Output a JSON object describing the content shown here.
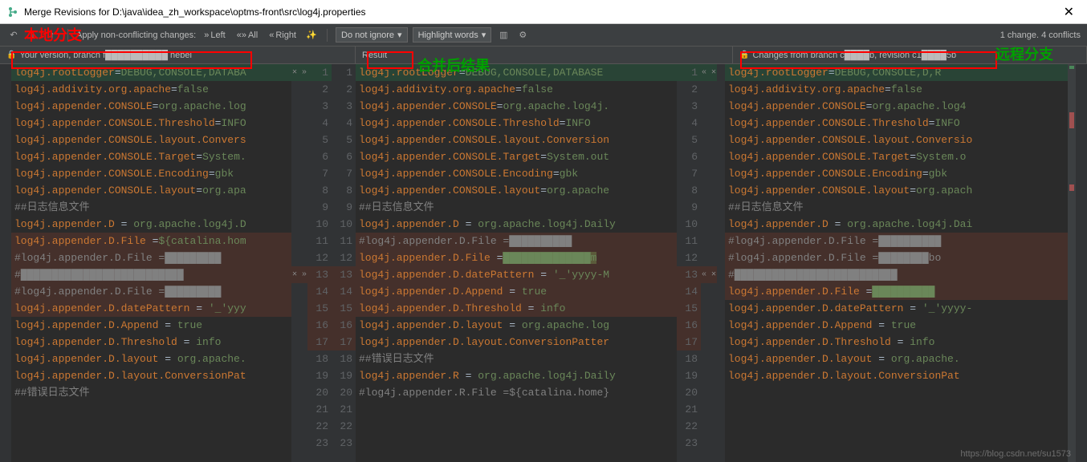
{
  "window": {
    "title": "Merge Revisions for D:\\java\\idea_zh_workspace\\optms-front\\src\\log4j.properties",
    "close": "✕"
  },
  "annotations": {
    "local": "本地分支",
    "result": "合并后结果",
    "remote": "远程分支"
  },
  "toolbar": {
    "apply_label": "Apply non-conflicting changes:",
    "left": "Left",
    "all": "All",
    "right": "Right",
    "ignore_dd": "Do not ignore",
    "highlight_dd": "Highlight words",
    "status": "1 change. 4 conflicts"
  },
  "headers": {
    "left": "Your version, branch f██████████ hebei",
    "center": "Result",
    "right": "Changes from branch c████b, revision c1████5b"
  },
  "code": {
    "left": [
      {
        "n": 1,
        "c": "diff-modify",
        "t": [
          [
            "key",
            "log4j.rootLogger"
          ],
          [
            "txt",
            "="
          ],
          [
            "val",
            "DEBUG,CONSOLE,DATABA"
          ]
        ]
      },
      {
        "n": 2,
        "t": [
          [
            "key",
            "log4j.addivity.org.apache"
          ],
          [
            "txt",
            "="
          ],
          [
            "val",
            "false"
          ]
        ]
      },
      {
        "n": 3,
        "t": []
      },
      {
        "n": 4,
        "t": [
          [
            "key",
            "log4j.appender.CONSOLE"
          ],
          [
            "txt",
            "="
          ],
          [
            "val",
            "org.apache.log"
          ]
        ]
      },
      {
        "n": 5,
        "t": [
          [
            "key",
            "log4j.appender.CONSOLE.Threshold"
          ],
          [
            "txt",
            "="
          ],
          [
            "val",
            "INFO"
          ]
        ]
      },
      {
        "n": 6,
        "t": [
          [
            "key",
            "log4j.appender.CONSOLE.layout.Convers"
          ]
        ]
      },
      {
        "n": 7,
        "t": [
          [
            "key",
            "log4j.appender.CONSOLE.Target"
          ],
          [
            "txt",
            "="
          ],
          [
            "val",
            "System."
          ]
        ]
      },
      {
        "n": 8,
        "t": [
          [
            "key",
            "log4j.appender.CONSOLE.Encoding"
          ],
          [
            "txt",
            "="
          ],
          [
            "val",
            "gbk"
          ]
        ]
      },
      {
        "n": 9,
        "t": [
          [
            "key",
            "log4j.appender.CONSOLE.layout"
          ],
          [
            "txt",
            "="
          ],
          [
            "val",
            "org.apa"
          ]
        ]
      },
      {
        "n": 10,
        "t": []
      },
      {
        "n": 11,
        "t": [
          [
            "comment",
            "##日志信息文件"
          ]
        ]
      },
      {
        "n": 12,
        "t": [
          [
            "key",
            "log4j.appender.D"
          ],
          [
            "txt",
            " = "
          ],
          [
            "val",
            "org.apache.log4j.D"
          ]
        ]
      },
      {
        "n": 13,
        "c": "diff-conflict",
        "t": [
          [
            "key",
            "log4j.appender.D.File"
          ],
          [
            "txt",
            " ="
          ],
          [
            "val",
            "${catalina.hom"
          ]
        ]
      },
      {
        "n": 14,
        "c": "diff-conflict",
        "t": [
          [
            "comment",
            "#log4j.appender.D.File =█████████"
          ]
        ]
      },
      {
        "n": 15,
        "c": "diff-conflict",
        "t": [
          [
            "comment",
            "#██████████████████████████"
          ]
        ]
      },
      {
        "n": 16,
        "c": "diff-conflict",
        "t": [
          [
            "comment",
            "#log4j.appender.D.File =█████████"
          ]
        ]
      },
      {
        "n": 17,
        "c": "diff-conflict",
        "t": [
          [
            "key",
            "log4j.appender.D.datePattern"
          ],
          [
            "txt",
            " = "
          ],
          [
            "val",
            "'_'yyy"
          ]
        ]
      },
      {
        "n": 18,
        "t": [
          [
            "key",
            "log4j.appender.D.Append"
          ],
          [
            "txt",
            " = "
          ],
          [
            "val",
            "true"
          ]
        ]
      },
      {
        "n": 19,
        "t": [
          [
            "key",
            "log4j.appender.D.Threshold"
          ],
          [
            "txt",
            " = "
          ],
          [
            "val",
            "info"
          ]
        ]
      },
      {
        "n": 20,
        "t": [
          [
            "key",
            "log4j.appender.D.layout"
          ],
          [
            "txt",
            " = "
          ],
          [
            "val",
            "org.apache."
          ]
        ]
      },
      {
        "n": 21,
        "t": [
          [
            "key",
            "log4j.appender.D.layout.ConversionPat"
          ]
        ]
      },
      {
        "n": 22,
        "t": []
      },
      {
        "n": 23,
        "t": [
          [
            "comment",
            "##错误日志文件"
          ]
        ]
      }
    ],
    "center_gutter": [
      {
        "l": 1,
        "r": 1,
        "la": "✕ »",
        "ra": "",
        "lc": "diff-modify"
      },
      {
        "l": 2,
        "r": 2
      },
      {
        "l": 3,
        "r": 3
      },
      {
        "l": 4,
        "r": 4
      },
      {
        "l": 5,
        "r": 5
      },
      {
        "l": 6,
        "r": 6
      },
      {
        "l": 7,
        "r": 7
      },
      {
        "l": 8,
        "r": 8
      },
      {
        "l": 9,
        "r": 9
      },
      {
        "l": 10,
        "r": 10
      },
      {
        "l": 11,
        "r": 11
      },
      {
        "l": 12,
        "r": 12
      },
      {
        "l": 13,
        "r": 13,
        "la": "✕ »",
        "ra": "« ✕",
        "lc": "diff-conflict",
        "rc": "diff-conflict"
      },
      {
        "l": 14,
        "r": 14,
        "la": "",
        "ra": "",
        "lc": "diff-conflict",
        "rc": "diff-conflict"
      },
      {
        "l": 15,
        "r": 15,
        "lc": "diff-conflict",
        "rc": "diff-conflict"
      },
      {
        "l": 16,
        "r": 16,
        "lc": "diff-conflict",
        "rc": "diff-conflict"
      },
      {
        "l": 17,
        "r": 17,
        "lc": "diff-conflict",
        "rc": "diff-conflict"
      },
      {
        "l": 18,
        "r": 18
      },
      {
        "l": 19,
        "r": 19
      },
      {
        "l": 20,
        "r": 20
      },
      {
        "l": 21,
        "r": 21
      },
      {
        "l": 22,
        "r": 22
      },
      {
        "l": 23,
        "r": 23
      }
    ],
    "center": [
      {
        "t": [
          [
            "key",
            "log4j.rootLogger"
          ],
          [
            "txt",
            "="
          ],
          [
            "val",
            "DEBUG,CONSOLE,DATABASE"
          ]
        ],
        "c": "diff-modify"
      },
      {
        "t": [
          [
            "key",
            "log4j.addivity.org.apache"
          ],
          [
            "txt",
            "="
          ],
          [
            "val",
            "false"
          ]
        ]
      },
      {
        "t": []
      },
      {
        "t": [
          [
            "key",
            "log4j.appender.CONSOLE"
          ],
          [
            "txt",
            "="
          ],
          [
            "val",
            "org.apache.log4j."
          ]
        ]
      },
      {
        "t": [
          [
            "key",
            "log4j.appender.CONSOLE.Threshold"
          ],
          [
            "txt",
            "="
          ],
          [
            "val",
            "INFO"
          ]
        ]
      },
      {
        "t": [
          [
            "key",
            "log4j.appender.CONSOLE.layout.Conversion"
          ]
        ]
      },
      {
        "t": [
          [
            "key",
            "log4j.appender.CONSOLE.Target"
          ],
          [
            "txt",
            "="
          ],
          [
            "val",
            "System.out"
          ]
        ]
      },
      {
        "t": [
          [
            "key",
            "log4j.appender.CONSOLE.Encoding"
          ],
          [
            "txt",
            "="
          ],
          [
            "val",
            "gbk"
          ]
        ]
      },
      {
        "t": [
          [
            "key",
            "log4j.appender.CONSOLE.layout"
          ],
          [
            "txt",
            "="
          ],
          [
            "val",
            "org.apache"
          ]
        ]
      },
      {
        "t": []
      },
      {
        "t": [
          [
            "comment",
            "##日志信息文件"
          ]
        ]
      },
      {
        "t": [
          [
            "key",
            "log4j.appender.D"
          ],
          [
            "txt",
            " = "
          ],
          [
            "val",
            "org.apache.log4j.Daily"
          ]
        ]
      },
      {
        "t": [
          [
            "comment",
            "#log4j.appender.D.File =██████████"
          ]
        ],
        "c": "diff-conflict"
      },
      {
        "t": [
          [
            "key",
            "log4j.appender.D.File"
          ],
          [
            "txt",
            " ="
          ],
          [
            "highlight",
            "██████████████m"
          ]
        ],
        "c": "diff-conflict"
      },
      {
        "t": [
          [
            "key",
            "log4j.appender.D.datePattern"
          ],
          [
            "txt",
            " = "
          ],
          [
            "val",
            "'_'yyyy-M"
          ]
        ],
        "c": "diff-conflict"
      },
      {
        "t": [
          [
            "key",
            "log4j.appender.D.Append"
          ],
          [
            "txt",
            " = "
          ],
          [
            "val",
            "true"
          ]
        ],
        "c": "diff-conflict"
      },
      {
        "t": [
          [
            "key",
            "log4j.appender.D.Threshold"
          ],
          [
            "txt",
            " = "
          ],
          [
            "val",
            "info"
          ]
        ],
        "c": "diff-conflict"
      },
      {
        "t": [
          [
            "key",
            "log4j.appender.D.layout"
          ],
          [
            "txt",
            " = "
          ],
          [
            "val",
            "org.apache.log"
          ]
        ]
      },
      {
        "t": [
          [
            "key",
            "log4j.appender.D.layout.ConversionPatter"
          ]
        ]
      },
      {
        "t": []
      },
      {
        "t": [
          [
            "comment",
            "##错误日志文件"
          ]
        ]
      },
      {
        "t": [
          [
            "key",
            "log4j.appender.R"
          ],
          [
            "txt",
            " = "
          ],
          [
            "val",
            "org.apache.log4j.Daily"
          ]
        ]
      },
      {
        "t": [
          [
            "comment",
            "#log4j.appender.R.File =${catalina.home}"
          ]
        ]
      }
    ],
    "right_gutter": [
      {
        "n": 1,
        "a": "« ✕",
        "c": "diff-modify"
      },
      {
        "n": 2
      },
      {
        "n": 3
      },
      {
        "n": 4
      },
      {
        "n": 5
      },
      {
        "n": 6
      },
      {
        "n": 7
      },
      {
        "n": 8
      },
      {
        "n": 9
      },
      {
        "n": 10
      },
      {
        "n": 11
      },
      {
        "n": 12
      },
      {
        "n": 13,
        "a": "« ✕",
        "c": "diff-conflict"
      },
      {
        "n": 14,
        "c": "diff-conflict"
      },
      {
        "n": 15,
        "c": "diff-conflict"
      },
      {
        "n": 16,
        "c": "diff-conflict"
      },
      {
        "n": 17,
        "c": "diff-conflict"
      },
      {
        "n": 18
      },
      {
        "n": 19
      },
      {
        "n": 20
      },
      {
        "n": 21
      },
      {
        "n": 22
      },
      {
        "n": 23
      }
    ],
    "right": [
      {
        "t": [
          [
            "key",
            "log4j.rootLogger"
          ],
          [
            "txt",
            "="
          ],
          [
            "val",
            "DEBUG,CONSOLE,D,R"
          ]
        ],
        "c": "diff-modify"
      },
      {
        "t": [
          [
            "key",
            "log4j.addivity.org.apache"
          ],
          [
            "txt",
            "="
          ],
          [
            "val",
            "false"
          ]
        ]
      },
      {
        "t": []
      },
      {
        "t": [
          [
            "key",
            "log4j.appender.CONSOLE"
          ],
          [
            "txt",
            "="
          ],
          [
            "val",
            "org.apache.log4"
          ]
        ]
      },
      {
        "t": [
          [
            "key",
            "log4j.appender.CONSOLE.Threshold"
          ],
          [
            "txt",
            "="
          ],
          [
            "val",
            "INFO"
          ]
        ]
      },
      {
        "t": [
          [
            "key",
            "log4j.appender.CONSOLE.layout.Conversio"
          ]
        ]
      },
      {
        "t": [
          [
            "key",
            "log4j.appender.CONSOLE.Target"
          ],
          [
            "txt",
            "="
          ],
          [
            "val",
            "System.o"
          ]
        ]
      },
      {
        "t": [
          [
            "key",
            "log4j.appender.CONSOLE.Encoding"
          ],
          [
            "txt",
            "="
          ],
          [
            "val",
            "gbk"
          ]
        ]
      },
      {
        "t": [
          [
            "key",
            "log4j.appender.CONSOLE.layout"
          ],
          [
            "txt",
            "="
          ],
          [
            "val",
            "org.apach"
          ]
        ]
      },
      {
        "t": []
      },
      {
        "t": [
          [
            "comment",
            "##日志信息文件"
          ]
        ]
      },
      {
        "t": [
          [
            "key",
            "log4j.appender.D"
          ],
          [
            "txt",
            " = "
          ],
          [
            "val",
            "org.apache.log4j.Dai"
          ]
        ]
      },
      {
        "t": [
          [
            "comment",
            "#log4j.appender.D.File =██████████"
          ]
        ],
        "c": "diff-conflict"
      },
      {
        "t": [
          [
            "comment",
            "#log4j.appender.D.File =████████bo"
          ]
        ],
        "c": "diff-conflict"
      },
      {
        "t": [
          [
            "comment",
            "#██████████████████████████"
          ]
        ],
        "c": "diff-conflict"
      },
      {
        "t": []
      },
      {
        "t": [
          [
            "key",
            "log4j.appender.D.File"
          ],
          [
            "txt",
            " ="
          ],
          [
            "highlight",
            "██████████"
          ]
        ],
        "c": "diff-conflict"
      },
      {
        "t": [
          [
            "key",
            "log4j.appender.D.datePattern"
          ],
          [
            "txt",
            " = "
          ],
          [
            "val",
            "'_'yyyy-"
          ]
        ]
      },
      {
        "t": [
          [
            "key",
            "log4j.appender.D.Append"
          ],
          [
            "txt",
            " = "
          ],
          [
            "val",
            "true"
          ]
        ]
      },
      {
        "t": [
          [
            "key",
            "log4j.appender.D.Threshold"
          ],
          [
            "txt",
            " = "
          ],
          [
            "val",
            "info"
          ]
        ]
      },
      {
        "t": [
          [
            "key",
            "log4j.appender.D.layout"
          ],
          [
            "txt",
            " = "
          ],
          [
            "val",
            "org.apache."
          ]
        ]
      },
      {
        "t": [
          [
            "key",
            "log4j.appender.D.layout.ConversionPat"
          ]
        ]
      },
      {
        "t": []
      }
    ]
  },
  "watermark": "https://blog.csdn.net/su1573"
}
